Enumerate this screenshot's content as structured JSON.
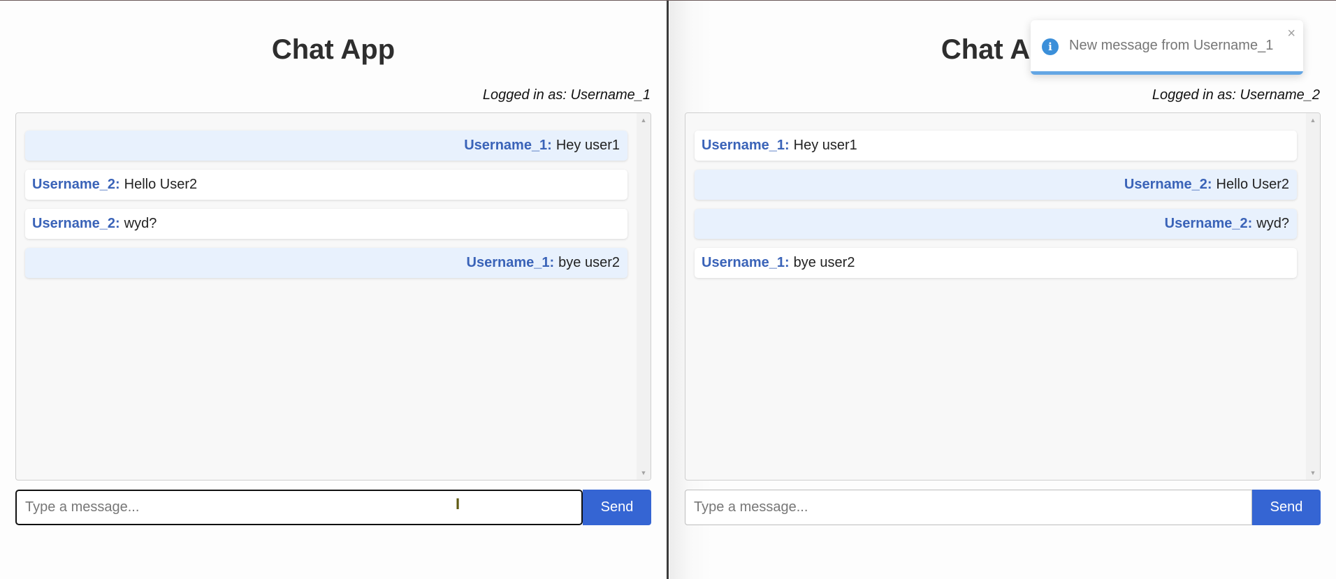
{
  "left": {
    "title": "Chat App",
    "logged_in": "Logged in as: Username_1",
    "messages": [
      {
        "user": "Username_1:",
        "text": "Hey user1"
      },
      {
        "user": "Username_2:",
        "text": "Hello User2"
      },
      {
        "user": "Username_2:",
        "text": "wyd?"
      },
      {
        "user": "Username_1:",
        "text": "bye user2"
      }
    ],
    "input_placeholder": "Type a message...",
    "send_label": "Send"
  },
  "right": {
    "title": "Chat App",
    "logged_in": "Logged in as: Username_2",
    "messages": [
      {
        "user": "Username_1:",
        "text": "Hey user1"
      },
      {
        "user": "Username_2:",
        "text": "Hello User2"
      },
      {
        "user": "Username_2:",
        "text": "wyd?"
      },
      {
        "user": "Username_1:",
        "text": "bye user2"
      }
    ],
    "input_placeholder": "Type a message...",
    "send_label": "Send"
  },
  "toast": {
    "message": "New message from Username_1",
    "icon": "info-icon",
    "close_icon": "close-icon",
    "close_glyph": "×"
  },
  "scrollbar": {
    "up_glyph": "▲",
    "down_glyph": "▼"
  },
  "colors": {
    "accent": "#3565d3",
    "username": "#3a63b8",
    "own_message_bg": "#e8f1fd",
    "toast_icon": "#3b8fd9"
  }
}
